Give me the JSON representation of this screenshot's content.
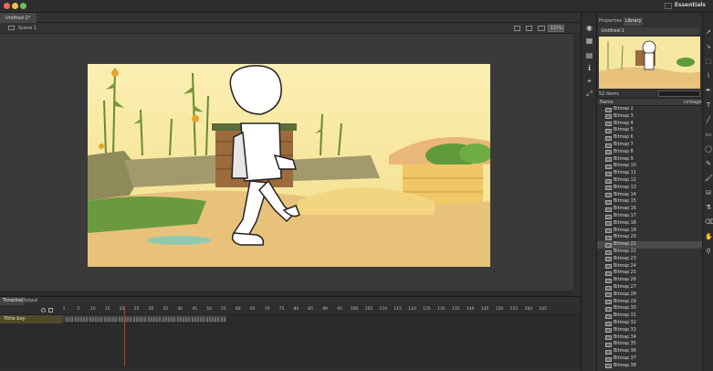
{
  "workspace": "Essentials",
  "document": {
    "tab_label": "Untitled-1*"
  },
  "scene": {
    "label": "Scene 1",
    "zoom": "137%"
  },
  "panel": {
    "tabs": [
      "Properties",
      "Library"
    ],
    "active_tab": "Library",
    "document_select": "Untitled-1",
    "item_count": "52 items",
    "columns": {
      "name": "Name",
      "linkage": "Linkage"
    },
    "selected_item": "Bitmap 21",
    "items": [
      "Bitmap 2",
      "Bitmap 3",
      "Bitmap 4",
      "Bitmap 5",
      "Bitmap 6",
      "Bitmap 7",
      "Bitmap 8",
      "Bitmap 9",
      "Bitmap 10",
      "Bitmap 11",
      "Bitmap 12",
      "Bitmap 13",
      "Bitmap 14",
      "Bitmap 15",
      "Bitmap 16",
      "Bitmap 17",
      "Bitmap 18",
      "Bitmap 19",
      "Bitmap 20",
      "Bitmap 21",
      "Bitmap 22",
      "Bitmap 23",
      "Bitmap 24",
      "Bitmap 25",
      "Bitmap 26",
      "Bitmap 27",
      "Bitmap 28",
      "Bitmap 29",
      "Bitmap 30",
      "Bitmap 31",
      "Bitmap 32",
      "Bitmap 33",
      "Bitmap 34",
      "Bitmap 35",
      "Bitmap 36",
      "Bitmap 37",
      "Bitmap 38"
    ]
  },
  "timeline": {
    "tabs": [
      "Timeline",
      "Output"
    ],
    "layer_name": "Tittle boy",
    "ruler": [
      "1",
      "5",
      "10",
      "15",
      "20",
      "25",
      "30",
      "35",
      "40",
      "45",
      "50",
      "55",
      "60",
      "65",
      "70",
      "75",
      "80",
      "85",
      "90",
      "95",
      "100",
      "105",
      "110",
      "115",
      "120",
      "125",
      "130",
      "135",
      "140",
      "145",
      "150",
      "155",
      "160",
      "165"
    ],
    "current_frame": 20
  },
  "colors": {
    "stage_sky": "#f6e7a0",
    "ground": "#e8c27b",
    "playhead": "#c0392b",
    "layer_highlight": "#4f4a2c"
  },
  "icons": {
    "tools": [
      "selection-icon",
      "subselection-icon",
      "free-transform-icon",
      "lasso-icon",
      "pen-icon",
      "text-icon",
      "line-icon",
      "rectangle-icon",
      "oval-icon",
      "pencil-icon",
      "brush-icon",
      "paint-bucket-icon",
      "eyedropper-icon",
      "eraser-icon",
      "hand-icon",
      "zoom-icon"
    ]
  }
}
